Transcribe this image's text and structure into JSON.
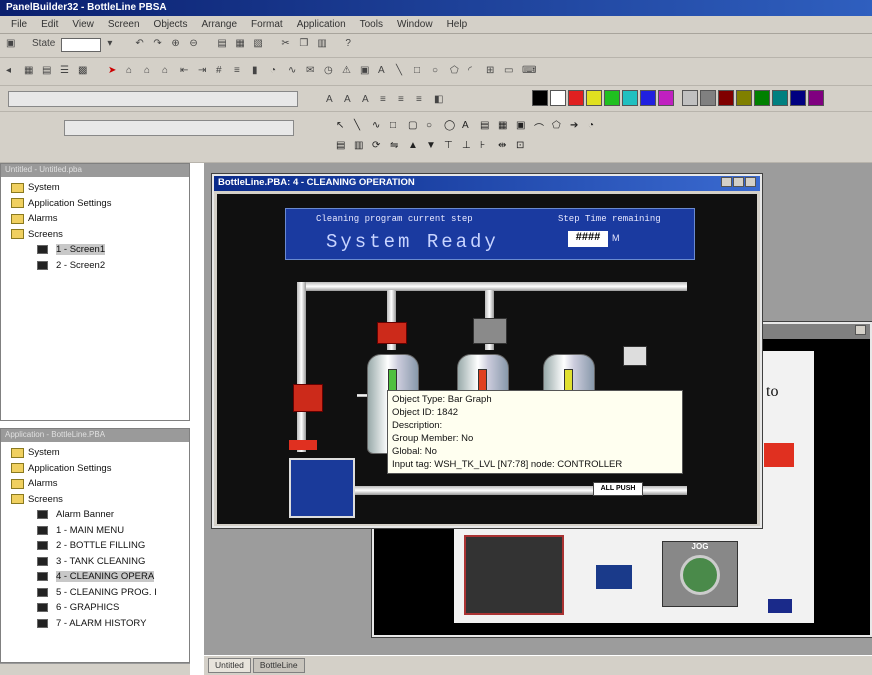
{
  "app": {
    "title": "PanelBuilder32 - BottleLine PBSA"
  },
  "menu": [
    "File",
    "Edit",
    "View",
    "Screen",
    "Objects",
    "Arrange",
    "Format",
    "Application",
    "Tools",
    "Window",
    "Help"
  ],
  "toolbar": {
    "state_label": "State",
    "palette": [
      "#000000",
      "#ffffff",
      "#e02020",
      "#e0e020",
      "#20c020",
      "#20c0c0",
      "#2020e0",
      "#c020c0",
      "#c0c0c0",
      "#808080",
      "#800000",
      "#808000",
      "#008000",
      "#008080",
      "#000080",
      "#800080"
    ]
  },
  "panel_top": {
    "title": "Untitled - Untitled.pba",
    "items": [
      {
        "label": "System",
        "kind": "folder"
      },
      {
        "label": "Application Settings",
        "kind": "folder"
      },
      {
        "label": "Alarms",
        "kind": "folder"
      },
      {
        "label": "Screens",
        "kind": "folder"
      },
      {
        "label": "1 - Screen1",
        "kind": "screen",
        "selected": true
      },
      {
        "label": "2 - Screen2",
        "kind": "screen"
      }
    ]
  },
  "panel_bottom": {
    "title": "Application - BottleLine.PBA",
    "items": [
      {
        "label": "System",
        "kind": "folder"
      },
      {
        "label": "Application Settings",
        "kind": "folder"
      },
      {
        "label": "Alarms",
        "kind": "folder"
      },
      {
        "label": "Screens",
        "kind": "folder"
      },
      {
        "label": "Alarm Banner",
        "kind": "screen"
      },
      {
        "label": "1 - MAIN MENU",
        "kind": "screen"
      },
      {
        "label": "2 - BOTTLE FILLING",
        "kind": "screen"
      },
      {
        "label": "3 - TANK CLEANING",
        "kind": "screen"
      },
      {
        "label": "4 - CLEANING OPERA",
        "kind": "screen",
        "selected": true
      },
      {
        "label": "5 - CLEANING PROG. I",
        "kind": "screen"
      },
      {
        "label": "6 - GRAPHICS",
        "kind": "screen"
      },
      {
        "label": "7 - ALARM HISTORY",
        "kind": "screen"
      }
    ]
  },
  "main_window": {
    "title": "BottleLine.PBA: 4 - CLEANING OPERATION",
    "hmi": {
      "header_left": "Cleaning program current step",
      "header_right": "Step Time remaining",
      "status": "System Ready",
      "step_value": "####",
      "min_label": "M",
      "button_label": "ALL PUSH"
    },
    "tooltip": {
      "lines": [
        "Object Type: Bar Graph",
        "Object ID: 1842",
        "Description:",
        "Group Member: No",
        "Global: No",
        "Input tag: WSH_TK_LVL [N7:78] node: CONTROLLER"
      ]
    }
  },
  "back_window": {
    "text_fragment": "to",
    "jog_label": "JOG"
  },
  "status_tabs": [
    "Untitled",
    "BottleLine"
  ]
}
